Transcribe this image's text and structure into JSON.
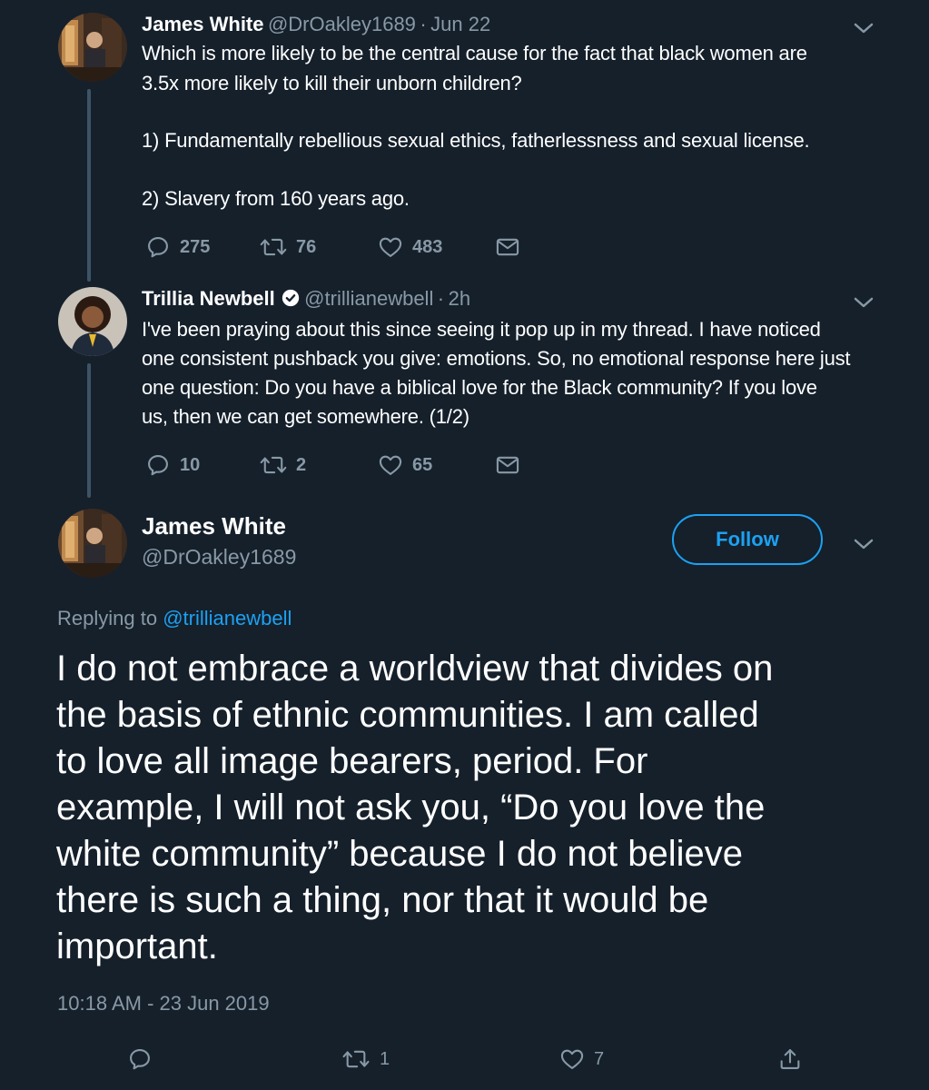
{
  "tweet1": {
    "name": "James White",
    "handle": "@DrOakley1689",
    "separator": "·",
    "date": "Jun 22",
    "lines": [
      "Which is more likely to be the central cause for the fact that black women are",
      "3.5x more likely to kill their unborn children?",
      "1) Fundamentally rebellious sexual ethics, fatherlessness and sexual license.",
      "2) Slavery from 160 years ago."
    ],
    "replies": "275",
    "retweets": "76",
    "likes": "483"
  },
  "tweet2": {
    "name": "Trillia Newbell",
    "handle": "@trillianewbell",
    "separator": "·",
    "date": "2h",
    "lines": [
      "I've been praying about this since seeing it pop up in my thread. I have noticed",
      "one consistent pushback you give: emotions. So, no emotional response here just",
      "one question: Do you have a biblical love for the Black community? If you love",
      "us, then we can get somewhere. (1/2)"
    ],
    "replies": "10",
    "retweets": "2",
    "likes": "65"
  },
  "main_tweet": {
    "name": "James White",
    "handle": "@DrOakley1689",
    "follow_label": "Follow",
    "replying_prefix": "Replying to",
    "replying_to": "@trillianewbell",
    "lines": [
      "I do not embrace a worldview that divides on",
      "the basis of ethnic communities. I am called",
      "to love all image bearers, period. For",
      "example, I will not ask you, “Do you love the",
      "white community” because I do not believe",
      "there is such a thing, nor that it would be",
      "important."
    ],
    "timestamp": "10:18 AM - 23 Jun 2019",
    "retweets": "1",
    "likes": "7"
  },
  "icons": {
    "reply": "reply-icon",
    "retweet": "retweet-icon",
    "like": "heart-icon",
    "dm": "mail-icon",
    "share": "share-icon",
    "more": "chevron-down-icon",
    "verified": "verified-badge-icon"
  },
  "colors": {
    "background": "#15202b",
    "text": "#ffffff",
    "muted": "#8899a6",
    "accent": "#1da1f2",
    "thread_line": "#3d5466"
  }
}
